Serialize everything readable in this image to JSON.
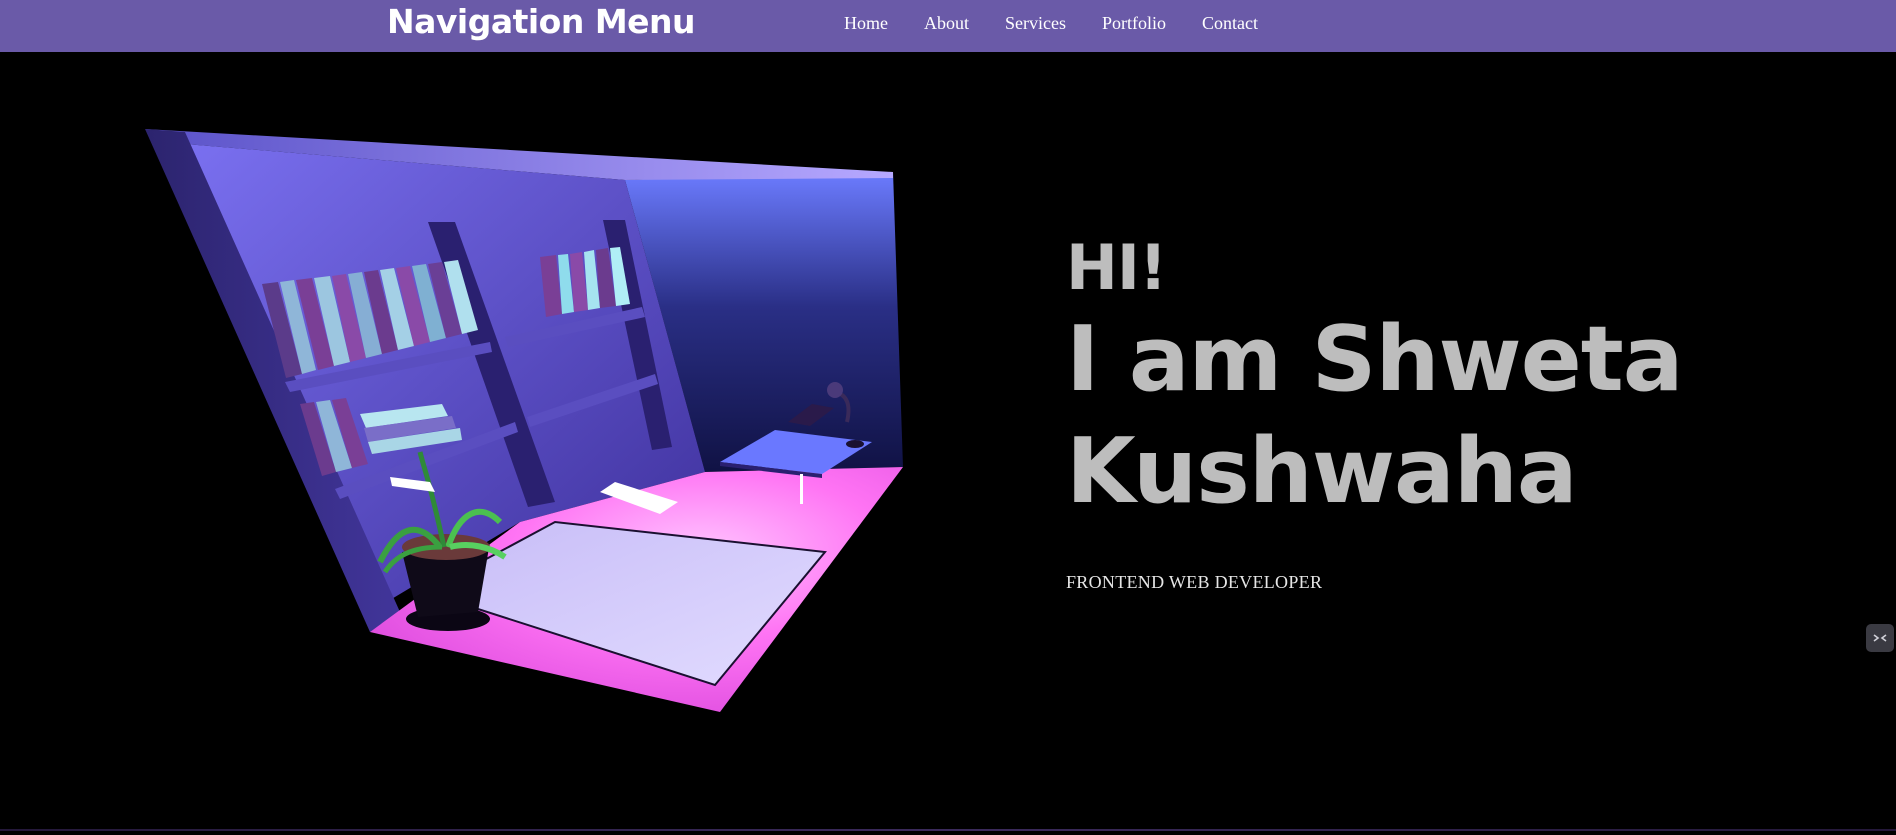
{
  "header": {
    "brand": "Navigation Menu",
    "nav_items": [
      "Home",
      "About",
      "Services",
      "Portfolio",
      "Contact"
    ]
  },
  "hero": {
    "greeting": "HI!",
    "name_line_1": "I am Shweta",
    "name_line_2": "Kushwaha",
    "role": "FRONTEND WEB DEVELOPER"
  },
  "illustration": {
    "subject": "isometric 3D room with bookshelves, desk lamp, desk, rug and potted plant"
  },
  "colors": {
    "nav_background": "#6a5aa8",
    "page_background": "#000000",
    "hero_text": "#bdbdbd",
    "floor_accent": "#ff6bf5",
    "wall_accent": "#7a6ef0"
  },
  "icons": {
    "widget": "collapse-arrows-icon"
  }
}
